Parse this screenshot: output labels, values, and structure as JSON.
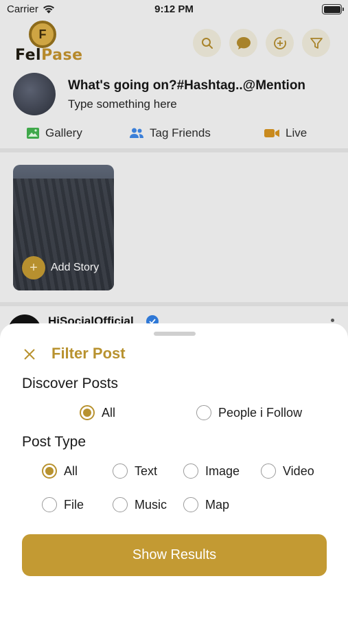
{
  "status_bar": {
    "carrier": "Carrier",
    "time": "9:12 PM"
  },
  "header": {
    "logo": {
      "brand_part1": "Fel",
      "brand_part2": "Pase",
      "mark": "F"
    },
    "actions": [
      "search-icon",
      "chat-icon",
      "add-circle-icon",
      "filter-icon"
    ]
  },
  "composer": {
    "prompt": "What's going on?#Hashtag..@Mention",
    "placeholder": "Type something here",
    "actions": [
      {
        "label": "Gallery",
        "icon": "gallery-icon",
        "color": "#3fa84a"
      },
      {
        "label": "Tag Friends",
        "icon": "tag-friends-icon",
        "color": "#3b7fd8"
      },
      {
        "label": "Live",
        "icon": "live-video-icon",
        "color": "#c98a1e"
      }
    ]
  },
  "stories": {
    "add_label": "Add Story"
  },
  "post_peek": {
    "name": "HiSocialOfficial"
  },
  "filter_sheet": {
    "title": "Filter Post",
    "discover": {
      "title": "Discover Posts",
      "options": [
        {
          "label": "All",
          "checked": true
        },
        {
          "label": "People i Follow",
          "checked": false
        }
      ]
    },
    "post_type": {
      "title": "Post Type",
      "options": [
        {
          "label": "All",
          "checked": true
        },
        {
          "label": "Text",
          "checked": false
        },
        {
          "label": "Image",
          "checked": false
        },
        {
          "label": "Video",
          "checked": false
        },
        {
          "label": "File",
          "checked": false
        },
        {
          "label": "Music",
          "checked": false
        },
        {
          "label": "Map",
          "checked": false
        }
      ]
    },
    "submit_label": "Show Results"
  },
  "colors": {
    "accent": "#b8922f",
    "button": "#c39a33",
    "verified": "#2f78d6"
  }
}
